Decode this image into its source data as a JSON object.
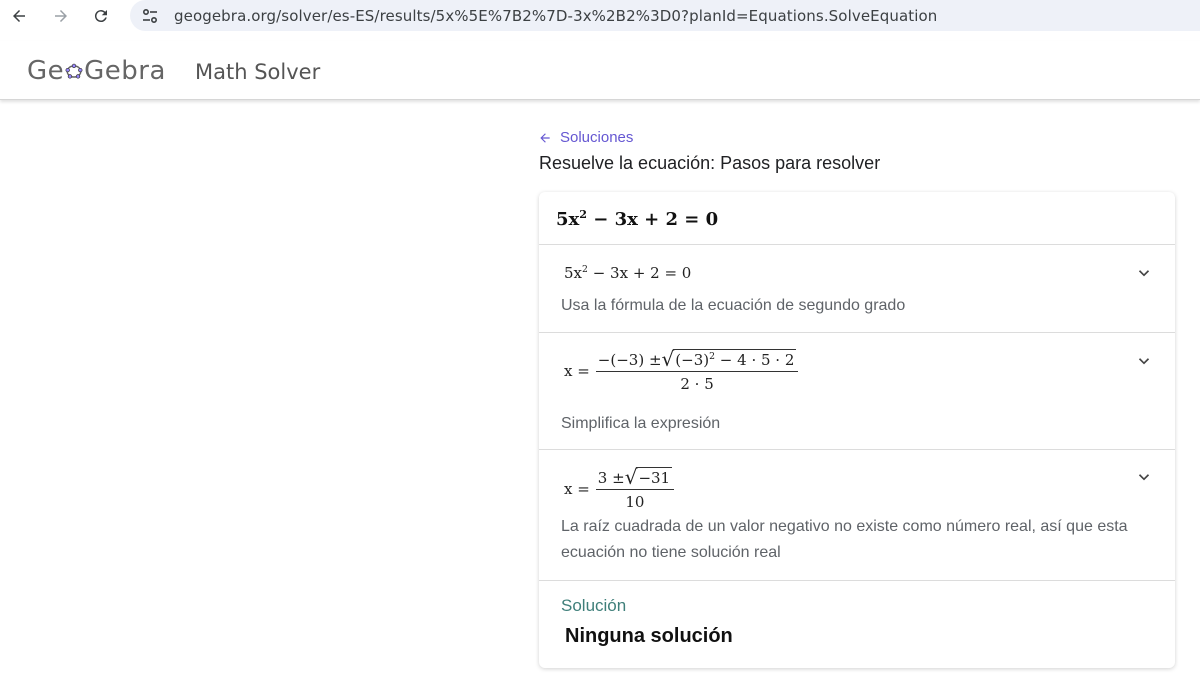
{
  "browser": {
    "url": "geogebra.org/solver/es-ES/results/5x%5E%7B2%7D-3x%2B2%3D0?planId=Equations.SolveEquation"
  },
  "header": {
    "logo_text_before": "Ge",
    "logo_text_after": "Gebra",
    "app_title": "Math Solver"
  },
  "content": {
    "back_label": "Soluciones",
    "page_title": "Resuelve la ecuación: Pasos para resolver",
    "equation": {
      "lhs_coef": "5x",
      "exp": "2",
      "rest": " − 3x + 2 = 0"
    },
    "steps": [
      {
        "expr_coef": "5x",
        "expr_exp": "2",
        "expr_rest": " − 3x + 2 = 0",
        "description": "Usa la fórmula de la ecuación de segundo grado"
      },
      {
        "lhs": "x =",
        "num_prefix": "−(−3) ± ",
        "rad_base": "(−3)",
        "rad_exp": "2",
        "rad_rest": " − 4 · 5 · 2",
        "den": "2 · 5",
        "description": "Simplifica la expresión"
      },
      {
        "lhs": "x =",
        "num_prefix": "3 ± ",
        "rad": "−31",
        "den": "10",
        "description": "La raíz cuadrada de un valor negativo no existe como número real, así que esta ecuación no tiene solución real"
      }
    ],
    "solution_label": "Solución",
    "solution_value": "Ninguna solución"
  },
  "colors": {
    "accent": "#6557d2",
    "solution": "#3f7f7a"
  }
}
